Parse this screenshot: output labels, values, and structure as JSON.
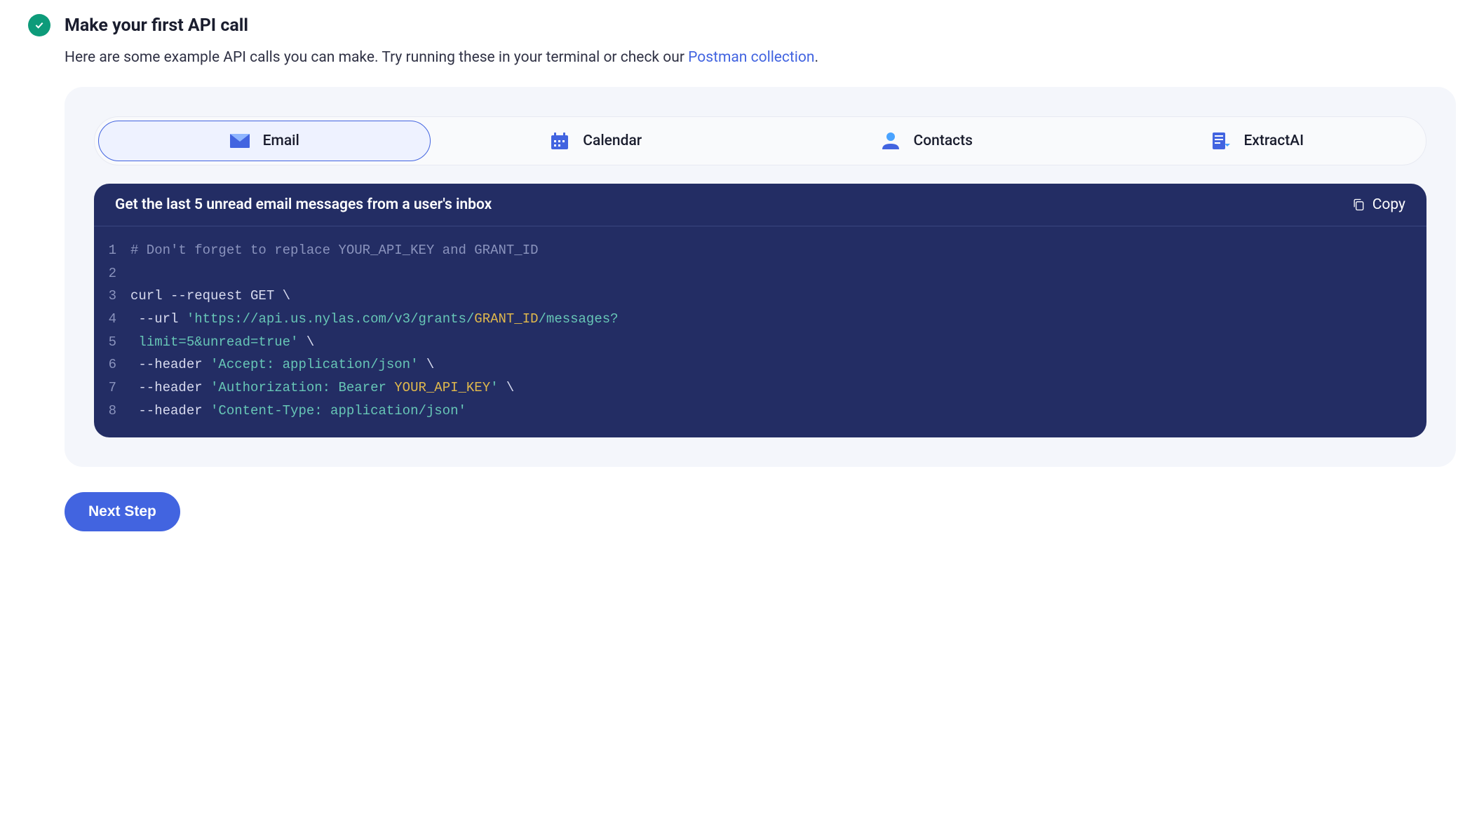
{
  "header": {
    "title": "Make your first API call",
    "intro_prefix": "Here are some example API calls you can make. Try running these in your terminal or check our ",
    "intro_link": "Postman collection",
    "intro_suffix": "."
  },
  "tabs": [
    {
      "label": "Email",
      "icon": "email-icon",
      "active": true
    },
    {
      "label": "Calendar",
      "icon": "calendar-icon",
      "active": false
    },
    {
      "label": "Contacts",
      "icon": "contacts-icon",
      "active": false
    },
    {
      "label": "ExtractAI",
      "icon": "extract-icon",
      "active": false
    }
  ],
  "codebox": {
    "title": "Get the last 5 unread email messages from a user's inbox",
    "copy_label": "Copy",
    "lines": [
      {
        "n": "1",
        "segments": [
          {
            "cls": "c-comment",
            "t": "# Don't forget to replace YOUR_API_KEY and GRANT_ID"
          }
        ]
      },
      {
        "n": "2",
        "segments": [
          {
            "cls": "c-plain",
            "t": ""
          }
        ]
      },
      {
        "n": "3",
        "segments": [
          {
            "cls": "c-plain",
            "t": "curl --request GET \\"
          }
        ]
      },
      {
        "n": "4",
        "segments": [
          {
            "cls": "c-plain",
            "t": " --url "
          },
          {
            "cls": "c-str",
            "t": "'https://api.us.nylas.com/v3/grants/"
          },
          {
            "cls": "c-var",
            "t": "GRANT_ID"
          },
          {
            "cls": "c-str",
            "t": "/messages?"
          }
        ]
      },
      {
        "n": "5",
        "segments": [
          {
            "cls": "c-str",
            "t": " limit=5&unread=true'"
          },
          {
            "cls": "c-plain",
            "t": " \\"
          }
        ]
      },
      {
        "n": "6",
        "segments": [
          {
            "cls": "c-plain",
            "t": " --header "
          },
          {
            "cls": "c-str",
            "t": "'Accept: application/json'"
          },
          {
            "cls": "c-plain",
            "t": " \\"
          }
        ]
      },
      {
        "n": "7",
        "segments": [
          {
            "cls": "c-plain",
            "t": " --header "
          },
          {
            "cls": "c-str",
            "t": "'Authorization: Bearer "
          },
          {
            "cls": "c-var",
            "t": "YOUR_API_KEY"
          },
          {
            "cls": "c-str",
            "t": "'"
          },
          {
            "cls": "c-plain",
            "t": " \\"
          }
        ]
      },
      {
        "n": "8",
        "segments": [
          {
            "cls": "c-plain",
            "t": " --header "
          },
          {
            "cls": "c-str",
            "t": "'Content-Type: application/json'"
          }
        ]
      }
    ]
  },
  "next_button": "Next Step"
}
